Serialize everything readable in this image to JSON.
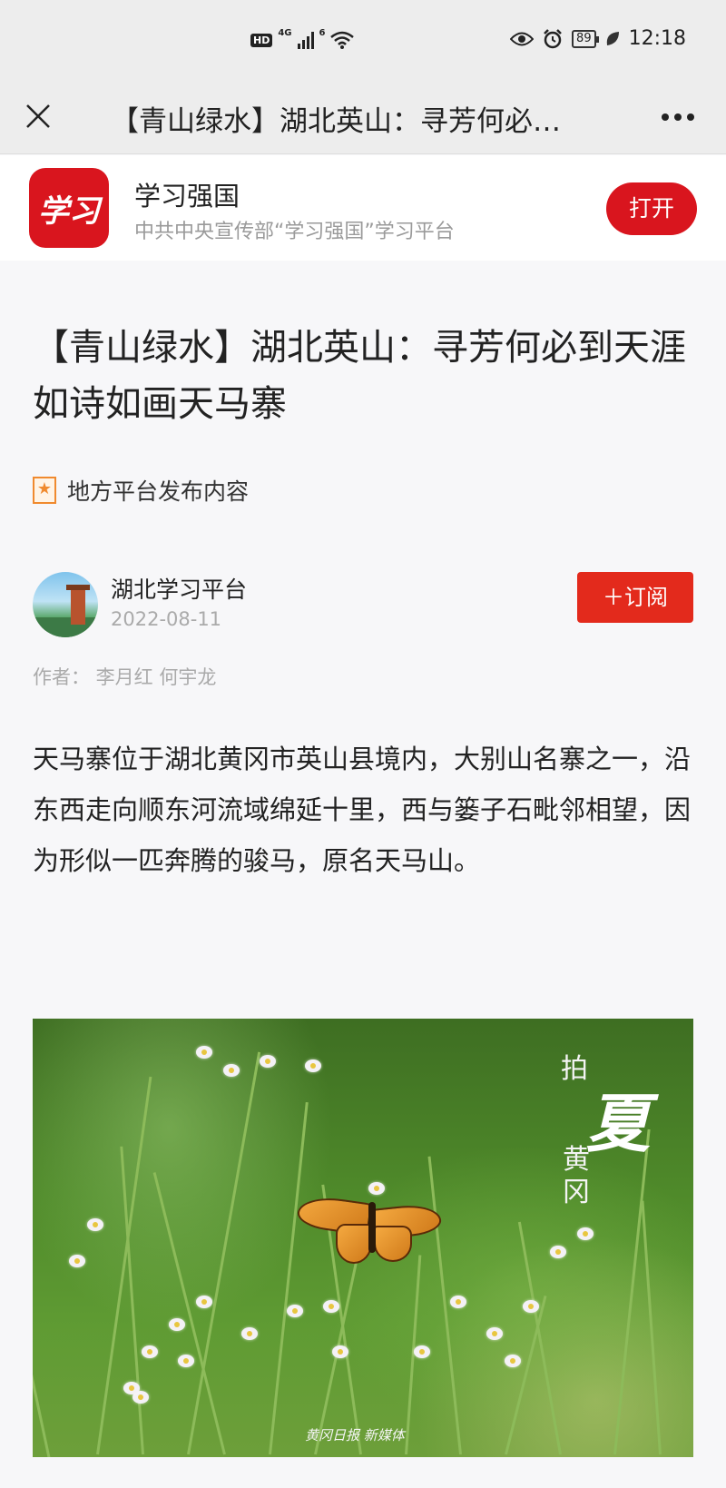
{
  "status_bar": {
    "hd": "HD",
    "network": "4G",
    "wifi_label": "6",
    "battery": "89",
    "time": "12:18",
    "icons": [
      "hd-icon",
      "signal-icon",
      "wifi-icon",
      "eye-icon",
      "alarm-icon",
      "battery-icon",
      "leaf-icon"
    ]
  },
  "nav": {
    "title": "【青山绿水】湖北英山：寻芳何必…",
    "close_icon": "close-icon",
    "more_icon": "more-icon"
  },
  "app_banner": {
    "logo_text": "学习",
    "name": "学习强国",
    "description": "中共中央宣传部“学习强国”学习平台",
    "open_label": "打开"
  },
  "article": {
    "headline": "【青山绿水】湖北英山：寻芳何必到天涯 如诗如画天马寨",
    "tag": "地方平台发布内容",
    "publisher": "湖北学习平台",
    "date": "2022-08-11",
    "subscribe_label": "＋订阅",
    "byline": "作者：   李月红 何宇龙",
    "body": "天马寨位于湖北黄冈市英山县境内，大别山名寨之一，沿东西走向顺东河流域绵延十里，西与篓子石毗邻相望，因为形似一匹奔腾的骏马，原名天马山。",
    "photo": {
      "overlay_pai": "拍",
      "overlay_xia": "夏",
      "overlay_hg": "黄冈",
      "watermark": "黄冈日报 新媒体"
    }
  }
}
